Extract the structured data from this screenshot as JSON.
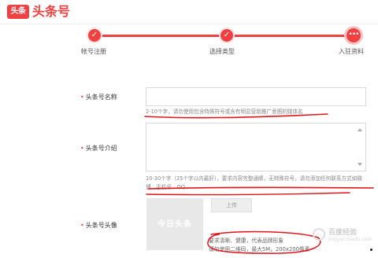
{
  "header": {
    "logo_badge": "头条",
    "logo_text": "头条号"
  },
  "steps": [
    {
      "label": "帐号注册",
      "icon": "check-icon",
      "state": "done"
    },
    {
      "label": "选择类型",
      "icon": "check-icon",
      "state": "done"
    },
    {
      "label": "入驻资料",
      "icon": "ellipsis-icon",
      "state": "current"
    }
  ],
  "step_glyphs": {
    "done": "✓",
    "current": "•••"
  },
  "form": {
    "required_mark": "•",
    "name": {
      "label": "头条号名称",
      "value": "",
      "hint": "2-10个字，请勿使用包含特殊符号或含有明显营销推广意图的媒体名"
    },
    "intro": {
      "label": "头条号介绍",
      "value": "",
      "hint": "10-30个字（25个字以内最好），要求内容完整通顺，无特殊符号，请勿添加任何联系方式如微博、手机号、QQ"
    },
    "avatar": {
      "label": "头条号头像",
      "placeholder_text": "今日头条",
      "upload_label": "上传",
      "requirements_line1": "要求清晰、健康，代表品牌形象",
      "requirements_line2": "请勿使用二维码，最大5M，200x200像素"
    }
  },
  "watermark": {
    "title": "百度经验",
    "subtitle": "jingyan.baidu.com"
  },
  "colors": {
    "brand": "#f04142",
    "annotation": "#e0151b"
  }
}
